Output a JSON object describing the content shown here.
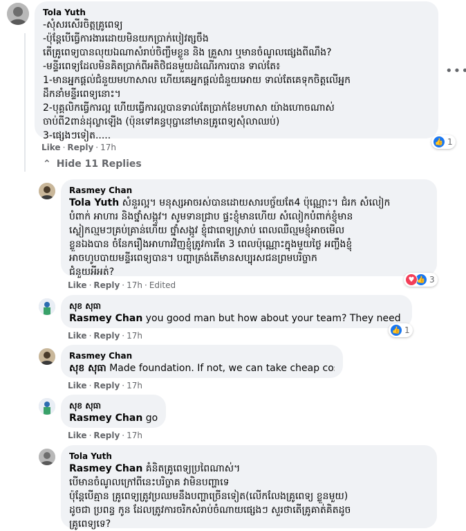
{
  "comments": [
    {
      "author": "Tola Yuth",
      "lines": [
        "-សុំសរសើរចិត្តគ្រូពេទ្យ",
        "-ប៉ុន្តែបើធ្វើការងារដោយមិនយកប្រាក់បៀវត្សចឹង",
        "តើគ្រូពេទ្យបានលុយឯណាសំរាប់ចិញ្ចឹមខ្លួន និង គ្រួសារ ឬមានចំណូលផ្សេងពីណឹង?",
        "-មន្ទីរពេទ្យដែលមិនគិតប្រាក់ពីអតិថិជនមួយដំណើរការបាន ទាល់តែ៖",
        "1-មានអ្នកផ្តល់ជំនួយមហាសាល ហើយគេអ្នកផ្តល់ជំនួយអោយ ទាល់តែគេទុកចិត្តលើអ្នក",
        "ដឹកនាំមន្ទីរពេទ្យនោះ។",
        "2-បុគ្គលិកធ្វើការល្អ ហើយធ្វើការល្អបានទាល់តែប្រាក់ខែមហាសា យ៉ាងហោចណាស់",
        "ចាប់ពី2ពាន់ដុល្លាឡើង (ប៉ុនទៅគន្ធបុប្ផានៅមានគ្រូពេទ្យសុំលាឈប់)",
        "3-ផ្សេងៗទៀត.....",
        ""
      ],
      "like": "Like",
      "reply": "Reply",
      "time": "17h",
      "edited": "",
      "reactions": {
        "count": "1"
      }
    },
    {
      "author": "Rasmey Chan",
      "mention": "Tola Yuth",
      "lines": [
        " សំនួរល្អ។ មនុស្សអាចរស់បានដោយសារបច្ច័យតែ4 ប៉ុណ្ណោះ។ ជំរក សំលៀក",
        "បំពាក់ អាហារ និងថ្នាំសង្កូវ។ សូមទានជ្រាប ផ្ទះខ្ញុំមានហើយ សំលៀកបំពាក់ខ្ញុំមាន",
        "ស្លៀកល្មមៗគ្រប់គ្រាន់ហើយ ថ្នាំសង្កូវ ខ្ញុំជាពេទ្យស្រាប់ ពេលឈឺល្មមខ្ញុំអាចមើល",
        "ខ្លួនឯងបាន ចំនែករឿងអាហារវិញខ្ញុំត្រូវការតែ 3 ពេលប៉ុណ្ណោះក្នុងមួយថ្ងៃ អញ្ចឹងខ្ញុំ",
        "អាចហូបបាយមន្ទីរពេទ្យបាន។ បញ្ហាត្រង់តើមានសប្បុរសជនព្រមបរិច្ចាក",
        "ជំនួយអីអត់?"
      ],
      "like": "Like",
      "reply": "Reply",
      "time": "17h",
      "edited": "Edited",
      "reactions": {
        "count": "3"
      }
    },
    {
      "author": "សុខ សុធា",
      "mention": "Rasmey Chan",
      "lines": [
        " you good man but how about your team? They need salery"
      ],
      "like": "Like",
      "reply": "Reply",
      "time": "17h",
      "edited": "",
      "reactions": {
        "count": "1"
      }
    },
    {
      "author": "Rasmey Chan",
      "mention": "សុខ សុធា",
      "lines": [
        " Made foundation. If not, we can take cheap cost."
      ],
      "like": "Like",
      "reply": "Reply",
      "time": "17h",
      "edited": ""
    },
    {
      "author": "សុខ សុធា",
      "mention": "Rasmey Chan",
      "lines": [
        " good"
      ],
      "like": "Like",
      "reply": "Reply",
      "time": "17h",
      "edited": ""
    },
    {
      "author": "Tola Yuth",
      "mention": "Rasmey Chan",
      "lines": [
        " គំនិតគ្រូពេទ្យប្រពៃណាស់។",
        "បើមានចំណូលក្រៅពីនេះបរិច្ចាគ វាមិនបញ្ហាទេ",
        "ប៉ុន្តែបើគ្មាន គ្រូពេទ្យត្រូវប្រឈមនឹងបញ្ហាច្រើនទៀត(លើកលែងគ្រូពេទ្យ ខ្លួនមួយ)",
        "ដូចជា ប្រពន្ធ កូន ដែលត្រូវការចរិកសំរាប់ចំណាយផ្សេងៗ សួរថាតើគ្រូគាត់គិតដូច",
        "គ្រូពេទ្យទេ?"
      ]
    }
  ],
  "thread": {
    "hide_replies": "Hide 11 Replies"
  },
  "menu": {
    "more": "•••"
  },
  "colors": {
    "like_blue": "#1877f2",
    "love_red": "#f33e58",
    "bubble_bg": "#f0f2f5",
    "meta_gray": "#65676b"
  }
}
